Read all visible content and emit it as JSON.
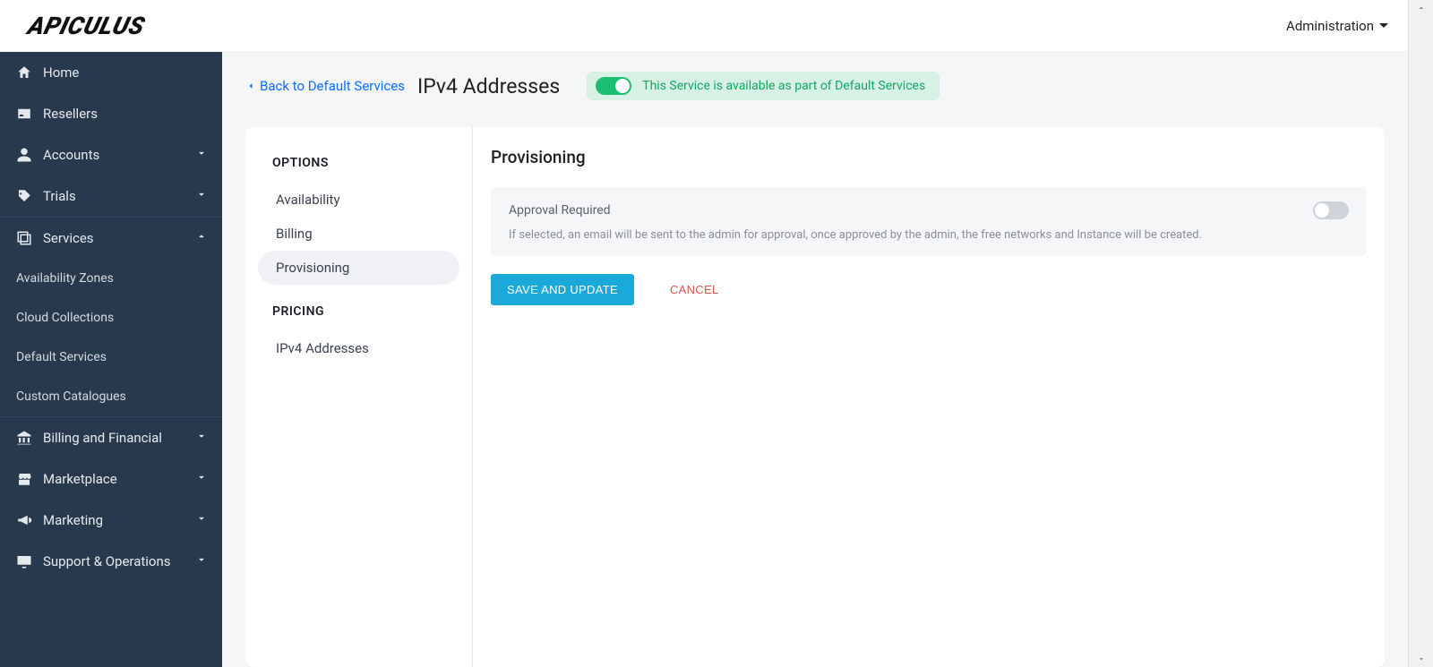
{
  "header": {
    "logo_text": "APICULUS",
    "admin_menu_label": "Administration"
  },
  "sidebar": {
    "home": "Home",
    "resellers": "Resellers",
    "accounts": "Accounts",
    "trials": "Trials",
    "services": "Services",
    "services_children": {
      "availability_zones": "Availability Zones",
      "cloud_collections": "Cloud Collections",
      "default_services": "Default Services",
      "custom_catalogues": "Custom Catalogues"
    },
    "billing_financial": "Billing and Financial",
    "marketplace": "Marketplace",
    "marketing": "Marketing",
    "support_operations": "Support & Operations"
  },
  "page": {
    "back_link": "Back to Default Services",
    "title": "IPv4 Addresses",
    "badge_text": "This Service is available as part of Default Services"
  },
  "left_panel": {
    "options_header": "OPTIONS",
    "options": {
      "availability": "Availability",
      "billing": "Billing",
      "provisioning": "Provisioning"
    },
    "pricing_header": "PRICING",
    "pricing": {
      "ipv4": "IPv4 Addresses"
    }
  },
  "right_panel": {
    "title": "Provisioning",
    "approval_label": "Approval Required",
    "approval_desc": "If selected, an email will be sent to the admin for approval, once approved by the admin, the free networks and Instance will be created.",
    "save_button": "SAVE AND UPDATE",
    "cancel_button": "CANCEL"
  }
}
